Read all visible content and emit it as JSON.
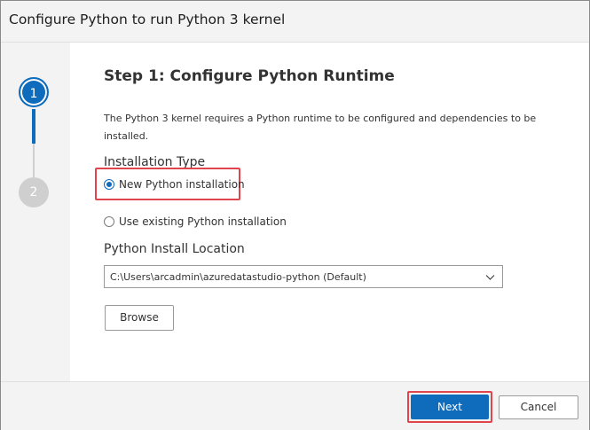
{
  "dialog": {
    "title": "Configure Python to run Python 3 kernel"
  },
  "stepper": {
    "steps": [
      {
        "number": "1",
        "state": "active"
      },
      {
        "number": "2",
        "state": "inactive"
      }
    ],
    "colors": {
      "active": "#0f6cbd",
      "inactive": "#cfcfcf"
    }
  },
  "content": {
    "heading": "Step 1: Configure Python Runtime",
    "description": "The Python 3 kernel requires a Python runtime to be configured and dependencies to be installed.",
    "installation_type": {
      "label": "Installation Type",
      "options": [
        {
          "label": "New Python installation",
          "selected": true
        },
        {
          "label": "Use existing Python installation",
          "selected": false
        }
      ]
    },
    "install_location": {
      "label": "Python Install Location",
      "value": "C:\\Users\\arcadmin\\azuredatastudio-python (Default)"
    },
    "browse_label": "Browse"
  },
  "footer": {
    "next_label": "Next",
    "cancel_label": "Cancel"
  },
  "annotation_color": "#e0454d"
}
